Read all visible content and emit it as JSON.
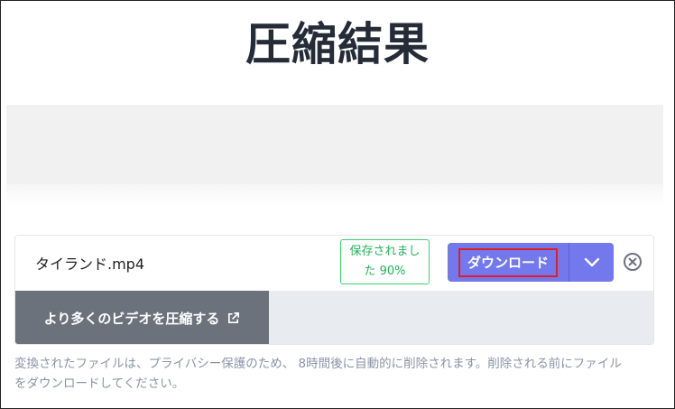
{
  "page": {
    "title": "圧縮結果"
  },
  "result": {
    "filename": "タイランド.mp4",
    "saved_line1": "保存されまし",
    "saved_line2": "た 90%",
    "download_label": "ダウンロード",
    "compress_more_label": "より多くのビデオを圧縮する"
  },
  "note": {
    "line1": "変換されたファイルは、プライバシー保護のため、 8時間後に自動的に削除されます。削除される前にファイル",
    "line2": "をダウンロードしてください。"
  },
  "icons": {
    "dropdown": "chevron-down-icon",
    "close": "close-circle-icon",
    "external": "external-link-icon"
  },
  "colors": {
    "accent": "#7378ec",
    "saved_green": "#22b35a",
    "highlight_outline": "#e02020"
  }
}
